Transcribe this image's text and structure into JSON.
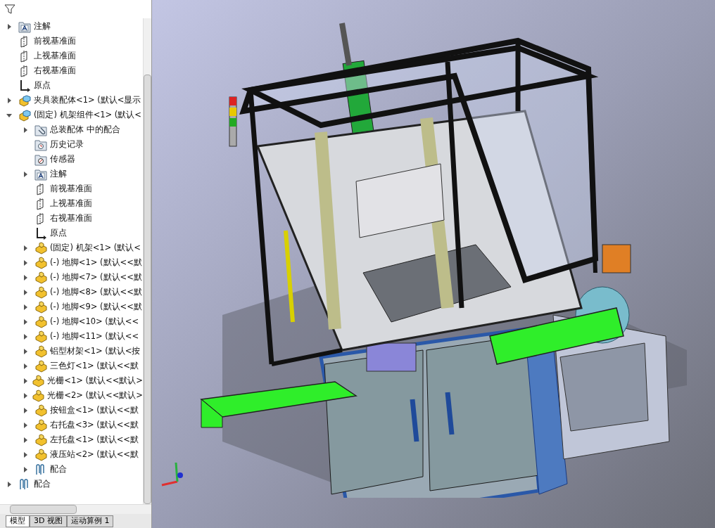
{
  "tree": [
    {
      "kind": "annotation",
      "label": "注解",
      "expandable": true,
      "expanded": false
    },
    {
      "kind": "plane",
      "label": "前视基准面",
      "expandable": false
    },
    {
      "kind": "plane",
      "label": "上视基准面",
      "expandable": false
    },
    {
      "kind": "plane",
      "label": "右视基准面",
      "expandable": false
    },
    {
      "kind": "origin",
      "label": "原点",
      "expandable": false
    },
    {
      "kind": "assembly",
      "label": "夹具装配体<1> (默认<显示",
      "expandable": true,
      "expanded": false
    },
    {
      "kind": "assembly",
      "label": "(固定) 机架组件<1> (默认<",
      "expandable": true,
      "expanded": true,
      "children": [
        {
          "kind": "mates-folder",
          "label": "总装配体 中的配合",
          "expandable": true,
          "expanded": false
        },
        {
          "kind": "history",
          "label": "历史记录",
          "expandable": false
        },
        {
          "kind": "sensor",
          "label": "传感器",
          "expandable": false
        },
        {
          "kind": "annotation",
          "label": "注解",
          "expandable": true,
          "expanded": false
        },
        {
          "kind": "plane",
          "label": "前视基准面",
          "expandable": false
        },
        {
          "kind": "plane",
          "label": "上视基准面",
          "expandable": false
        },
        {
          "kind": "plane",
          "label": "右视基准面",
          "expandable": false
        },
        {
          "kind": "origin",
          "label": "原点",
          "expandable": false
        },
        {
          "kind": "part",
          "label": "(固定) 机架<1> (默认<",
          "expandable": true,
          "expanded": false
        },
        {
          "kind": "part",
          "label": "(-) 地脚<1> (默认<<默",
          "expandable": true,
          "expanded": false
        },
        {
          "kind": "part",
          "label": "(-) 地脚<7> (默认<<默",
          "expandable": true,
          "expanded": false
        },
        {
          "kind": "part",
          "label": "(-) 地脚<8> (默认<<默",
          "expandable": true,
          "expanded": false
        },
        {
          "kind": "part",
          "label": "(-) 地脚<9> (默认<<默",
          "expandable": true,
          "expanded": false
        },
        {
          "kind": "part",
          "label": "(-) 地脚<10> (默认<<",
          "expandable": true,
          "expanded": false
        },
        {
          "kind": "part",
          "label": "(-) 地脚<11> (默认<<",
          "expandable": true,
          "expanded": false
        },
        {
          "kind": "part",
          "label": "铝型材架<1> (默认<按",
          "expandable": true,
          "expanded": false
        },
        {
          "kind": "part",
          "label": "三色灯<1> (默认<<默",
          "expandable": true,
          "expanded": false
        },
        {
          "kind": "part",
          "label": "光栅<1> (默认<<默认>",
          "expandable": true,
          "expanded": false
        },
        {
          "kind": "part",
          "label": "光栅<2> (默认<<默认>",
          "expandable": true,
          "expanded": false
        },
        {
          "kind": "part",
          "label": "按钮盒<1> (默认<<默",
          "expandable": true,
          "expanded": false
        },
        {
          "kind": "part",
          "label": "右托盘<3> (默认<<默",
          "expandable": true,
          "expanded": false
        },
        {
          "kind": "part",
          "label": "左托盘<1> (默认<<默",
          "expandable": true,
          "expanded": false
        },
        {
          "kind": "part",
          "label": "液压站<2> (默认<<默",
          "expandable": true,
          "expanded": false
        },
        {
          "kind": "mates",
          "label": "配合",
          "expandable": true,
          "expanded": false
        }
      ]
    },
    {
      "kind": "mates",
      "label": "配合",
      "expandable": true,
      "expanded": false
    }
  ],
  "tabs": [
    {
      "label": "模型",
      "selected": true
    },
    {
      "label": "3D 视图",
      "selected": false
    },
    {
      "label": "运动算例 1",
      "selected": false
    }
  ]
}
